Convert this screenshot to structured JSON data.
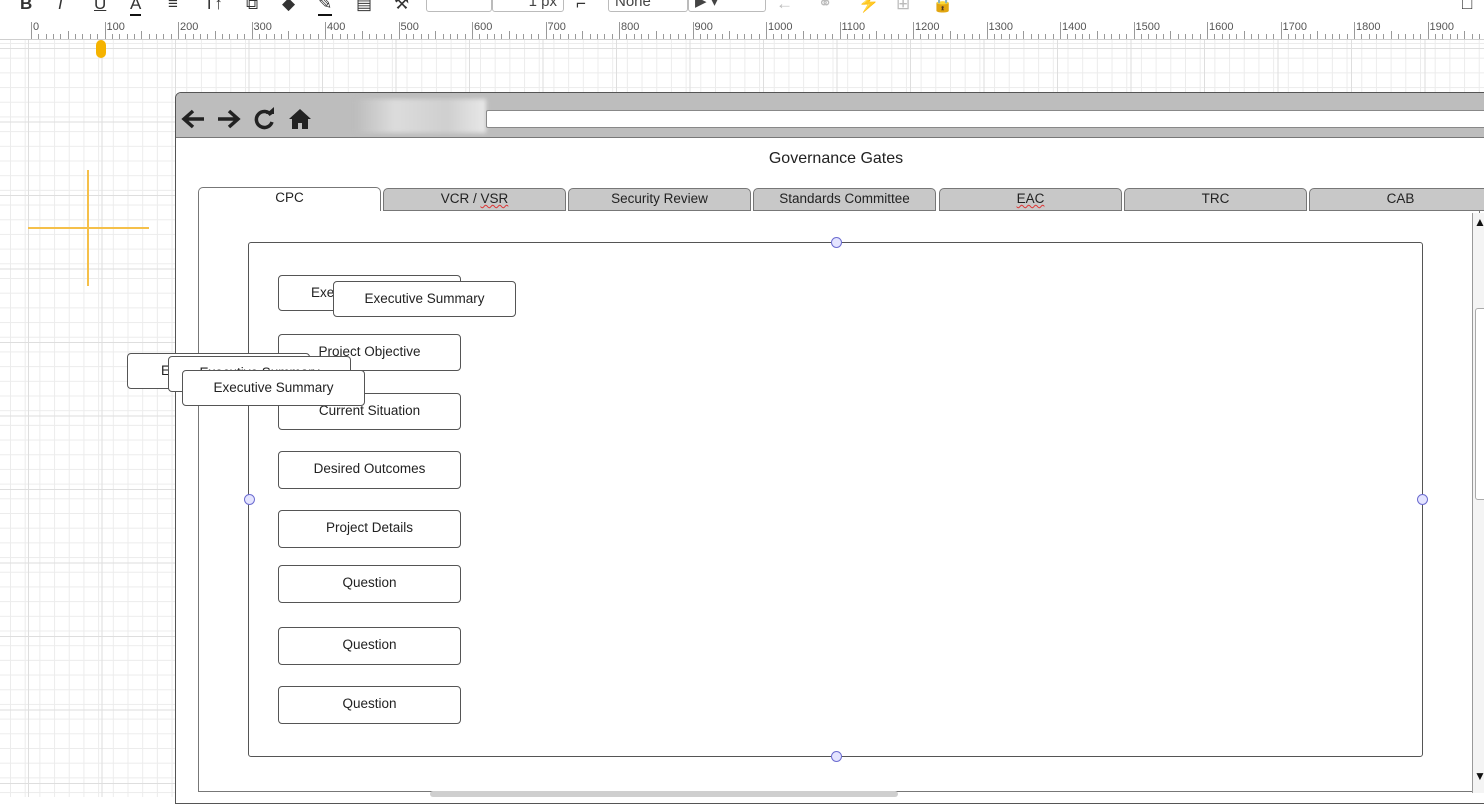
{
  "toolbar": {
    "bold": "B",
    "italic": "I",
    "underline": "U",
    "font_color": "A",
    "line_width": "1 px",
    "line_style": "None"
  },
  "ruler": {
    "labels": [
      "0",
      "100",
      "200",
      "300",
      "400",
      "500",
      "600",
      "700",
      "800",
      "900",
      "1000",
      "1100",
      "1200",
      "1300",
      "1400",
      "1500",
      "1600",
      "1700",
      "1800",
      "1900"
    ]
  },
  "browser": {
    "nav": {
      "back": "🡐",
      "forward": "🡒",
      "reload": "↻",
      "home": "⌂"
    },
    "title": "Governance Gates",
    "tabs": [
      {
        "label": "CPC",
        "active": true
      },
      {
        "label": "VCR / VSR"
      },
      {
        "label": "Security Review"
      },
      {
        "label": "Standards Committee"
      },
      {
        "label": "EAC"
      },
      {
        "label": "TRC"
      },
      {
        "label": "CAB"
      }
    ]
  },
  "buttons": {
    "exec_summary_under": "Executive Summary",
    "exec_summary_top": "Executive Summary",
    "project_objective": "Project Objective",
    "current_situation": "Current Situation",
    "desired_outcomes": "Desired Outcomes",
    "project_details": "Project Details",
    "question_1": "Question",
    "question_2": "Question",
    "question_3": "Question",
    "floating_1": "Executive Summary",
    "floating_2": "Executive Summary",
    "floating_3": "Executive Summary"
  }
}
